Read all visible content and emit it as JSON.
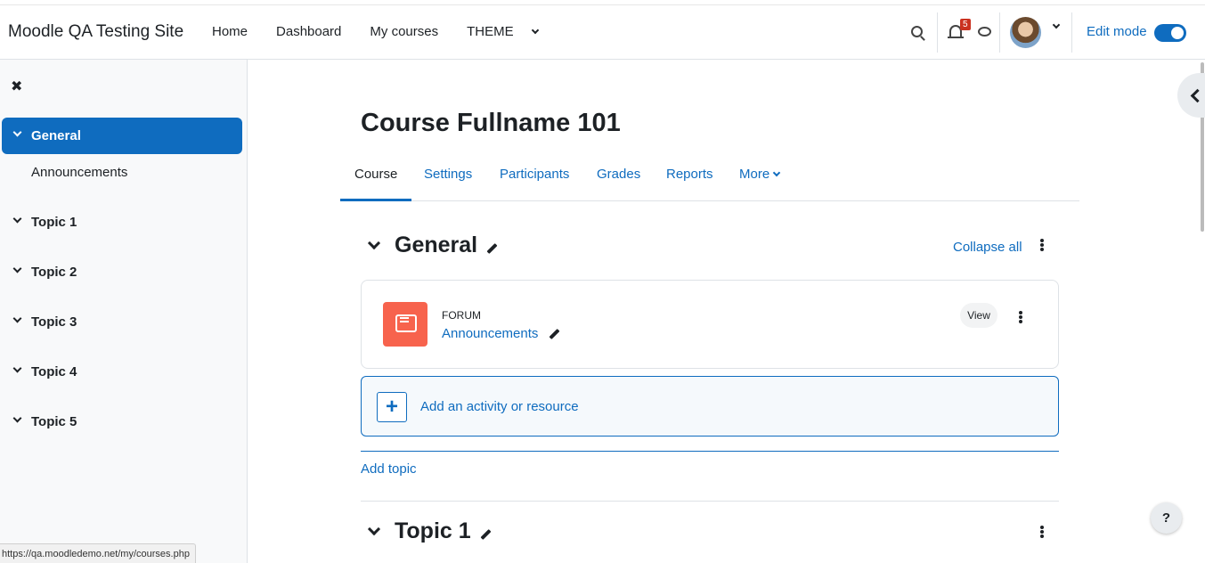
{
  "site": {
    "name": "Moodle QA Testing Site"
  },
  "primary_nav": [
    {
      "label": "Home"
    },
    {
      "label": "Dashboard"
    },
    {
      "label": "My courses"
    },
    {
      "label": "THEME"
    }
  ],
  "header_right": {
    "notifications_count": "5",
    "edit_mode_label": "Edit mode",
    "edit_mode_on": true
  },
  "sidebar": {
    "items": [
      {
        "label": "General",
        "active": true
      },
      {
        "label": "Topic 1"
      },
      {
        "label": "Topic 2"
      },
      {
        "label": "Topic 3"
      },
      {
        "label": "Topic 4"
      },
      {
        "label": "Topic 5"
      }
    ],
    "sub_items": [
      {
        "label": "Announcements"
      }
    ]
  },
  "course": {
    "title": "Course Fullname 101",
    "tabs": [
      {
        "label": "Course",
        "active": true
      },
      {
        "label": "Settings"
      },
      {
        "label": "Participants"
      },
      {
        "label": "Grades"
      },
      {
        "label": "Reports"
      },
      {
        "label": "More"
      }
    ],
    "collapse_all": "Collapse all",
    "sections": [
      {
        "title": "General",
        "activities": [
          {
            "type": "FORUM",
            "name": "Announcements",
            "view_label": "View"
          }
        ]
      },
      {
        "title": "Topic 1"
      }
    ],
    "add_activity_label": "Add an activity or resource",
    "add_topic_label": "Add topic"
  },
  "help": {
    "label": "?"
  },
  "status_bar": {
    "url": "https://qa.moodledemo.net/my/courses.php"
  },
  "colors": {
    "primary": "#0f6cbf",
    "forum_icon": "#f7634d",
    "badge": "#ca3120"
  },
  "icons": [
    "search-icon",
    "bell-icon",
    "message-icon",
    "avatar",
    "close-icon",
    "chevron-down-icon",
    "pencil-icon",
    "kebab-icon",
    "forum-icon",
    "plus-icon",
    "chevron-left-icon",
    "help-icon"
  ]
}
